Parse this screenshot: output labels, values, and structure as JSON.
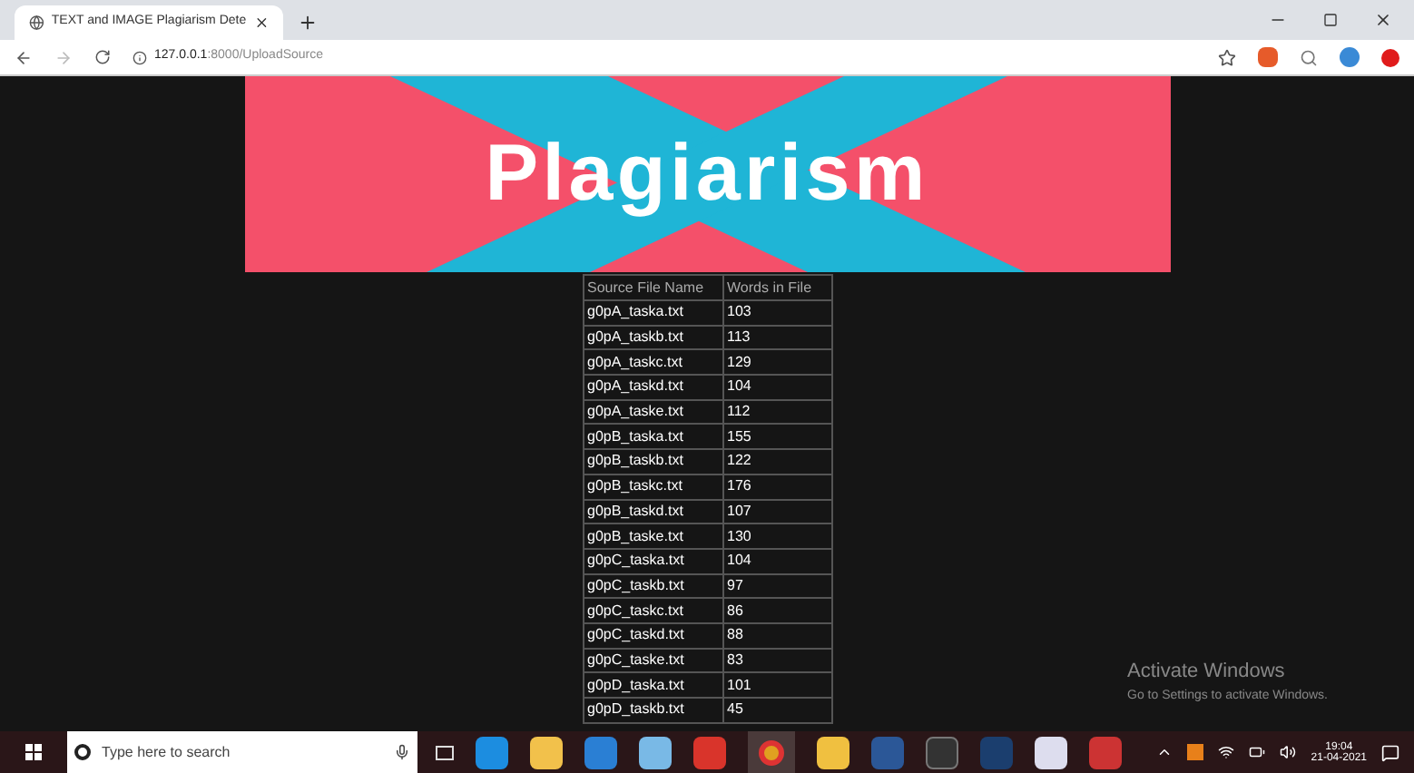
{
  "browser": {
    "tab_title": "TEXT and IMAGE Plagiarism Dete",
    "url_host": "127.0.0.1",
    "url_rest": ":8000/UploadSource"
  },
  "banner": {
    "title": "Plagiarism"
  },
  "table": {
    "columns": [
      "Source File Name",
      "Words in File"
    ],
    "rows": [
      [
        "g0pA_taska.txt",
        "103"
      ],
      [
        "g0pA_taskb.txt",
        "113"
      ],
      [
        "g0pA_taskc.txt",
        "129"
      ],
      [
        "g0pA_taskd.txt",
        "104"
      ],
      [
        "g0pA_taske.txt",
        "112"
      ],
      [
        "g0pB_taska.txt",
        "155"
      ],
      [
        "g0pB_taskb.txt",
        "122"
      ],
      [
        "g0pB_taskc.txt",
        "176"
      ],
      [
        "g0pB_taskd.txt",
        "107"
      ],
      [
        "g0pB_taske.txt",
        "130"
      ],
      [
        "g0pC_taska.txt",
        "104"
      ],
      [
        "g0pC_taskb.txt",
        "97"
      ],
      [
        "g0pC_taskc.txt",
        "86"
      ],
      [
        "g0pC_taskd.txt",
        "88"
      ],
      [
        "g0pC_taske.txt",
        "83"
      ],
      [
        "g0pD_taska.txt",
        "101"
      ],
      [
        "g0pD_taskb.txt",
        "45"
      ]
    ]
  },
  "watermark": {
    "title": "Activate Windows",
    "subtitle": "Go to Settings to activate Windows."
  },
  "taskbar": {
    "search_placeholder": "Type here to search",
    "time": "19:04",
    "date": "21-04-2021"
  }
}
